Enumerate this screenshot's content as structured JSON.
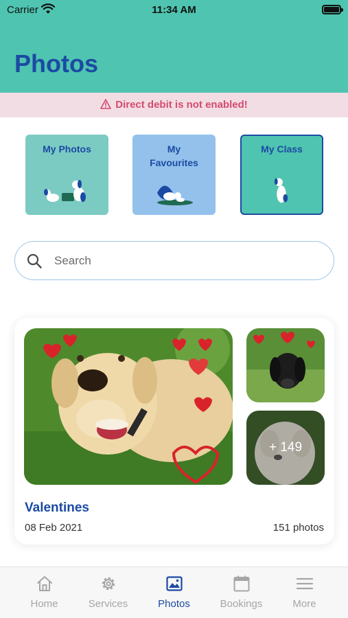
{
  "status_bar": {
    "carrier": "Carrier",
    "time": "11:34 AM"
  },
  "header": {
    "title": "Photos"
  },
  "alert": {
    "text": "Direct debit is not enabled!"
  },
  "categories": [
    {
      "label": "My Photos"
    },
    {
      "label": "My Favourites"
    },
    {
      "label": "My Class"
    }
  ],
  "search": {
    "placeholder": "Search"
  },
  "album": {
    "title": "Valentines",
    "date": "08 Feb 2021",
    "count": "151 photos",
    "more": "+ 149"
  },
  "tabs": [
    {
      "label": "Home",
      "icon": "home-icon"
    },
    {
      "label": "Services",
      "icon": "gear-icon"
    },
    {
      "label": "Photos",
      "icon": "image-icon",
      "active": true
    },
    {
      "label": "Bookings",
      "icon": "calendar-icon"
    },
    {
      "label": "More",
      "icon": "menu-icon"
    }
  ],
  "colors": {
    "header": "#4fc4b0",
    "brand": "#1b4aa3",
    "alert_text": "#d34a6e",
    "alert_bg": "#f3dde4"
  }
}
